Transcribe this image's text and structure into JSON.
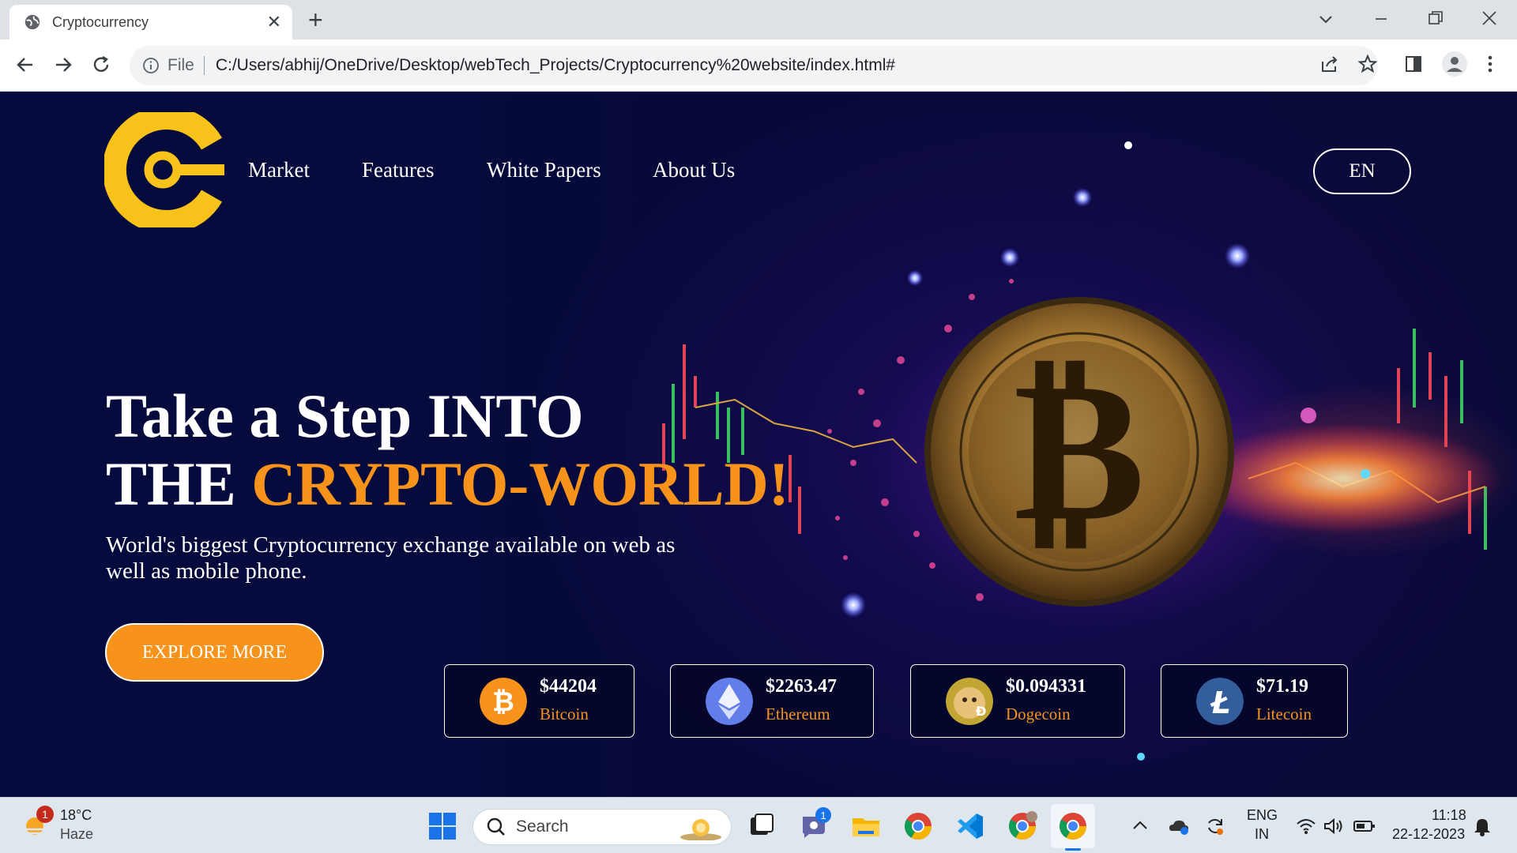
{
  "browser": {
    "tab_title": "Cryptocurrency",
    "close_glyph": "✕",
    "newtab_glyph": "+",
    "omnibox_label": "File",
    "url": "C:/Users/abhij/OneDrive/Desktop/webTech_Projects/Cryptocurrency%20website/index.html#"
  },
  "site": {
    "nav": [
      "Market",
      "Features",
      "White Papers",
      "About Us"
    ],
    "lang_button": "EN",
    "hero_line1": "Take a Step INTO",
    "hero_line2_plain": "THE ",
    "hero_line2_accent": "CRYPTO-WORLD!",
    "subtitle": "World's biggest Cryptocurrency exchange available on web as well as mobile phone.",
    "cta": "EXPLORE MORE",
    "accent_color": "#f7931a",
    "coins": [
      {
        "price": "$44204",
        "name": "Bitcoin",
        "icon": "bitcoin-icon",
        "color": "#f7931a"
      },
      {
        "price": "$2263.47",
        "name": "Ethereum",
        "icon": "ethereum-icon",
        "color": "#627eea"
      },
      {
        "price": "$0.094331",
        "name": "Dogecoin",
        "icon": "dogecoin-icon",
        "color": "#c2a633"
      },
      {
        "price": "$71.19",
        "name": "Litecoin",
        "icon": "litecoin-icon",
        "color": "#345d9d"
      }
    ]
  },
  "taskbar": {
    "weather_temp": "18°C",
    "weather_desc": "Haze",
    "weather_badge": "1",
    "search_label": "Search",
    "teams_badge": "1",
    "lang_line1": "ENG",
    "lang_line2": "IN",
    "time": "11:18",
    "date": "22-12-2023"
  }
}
